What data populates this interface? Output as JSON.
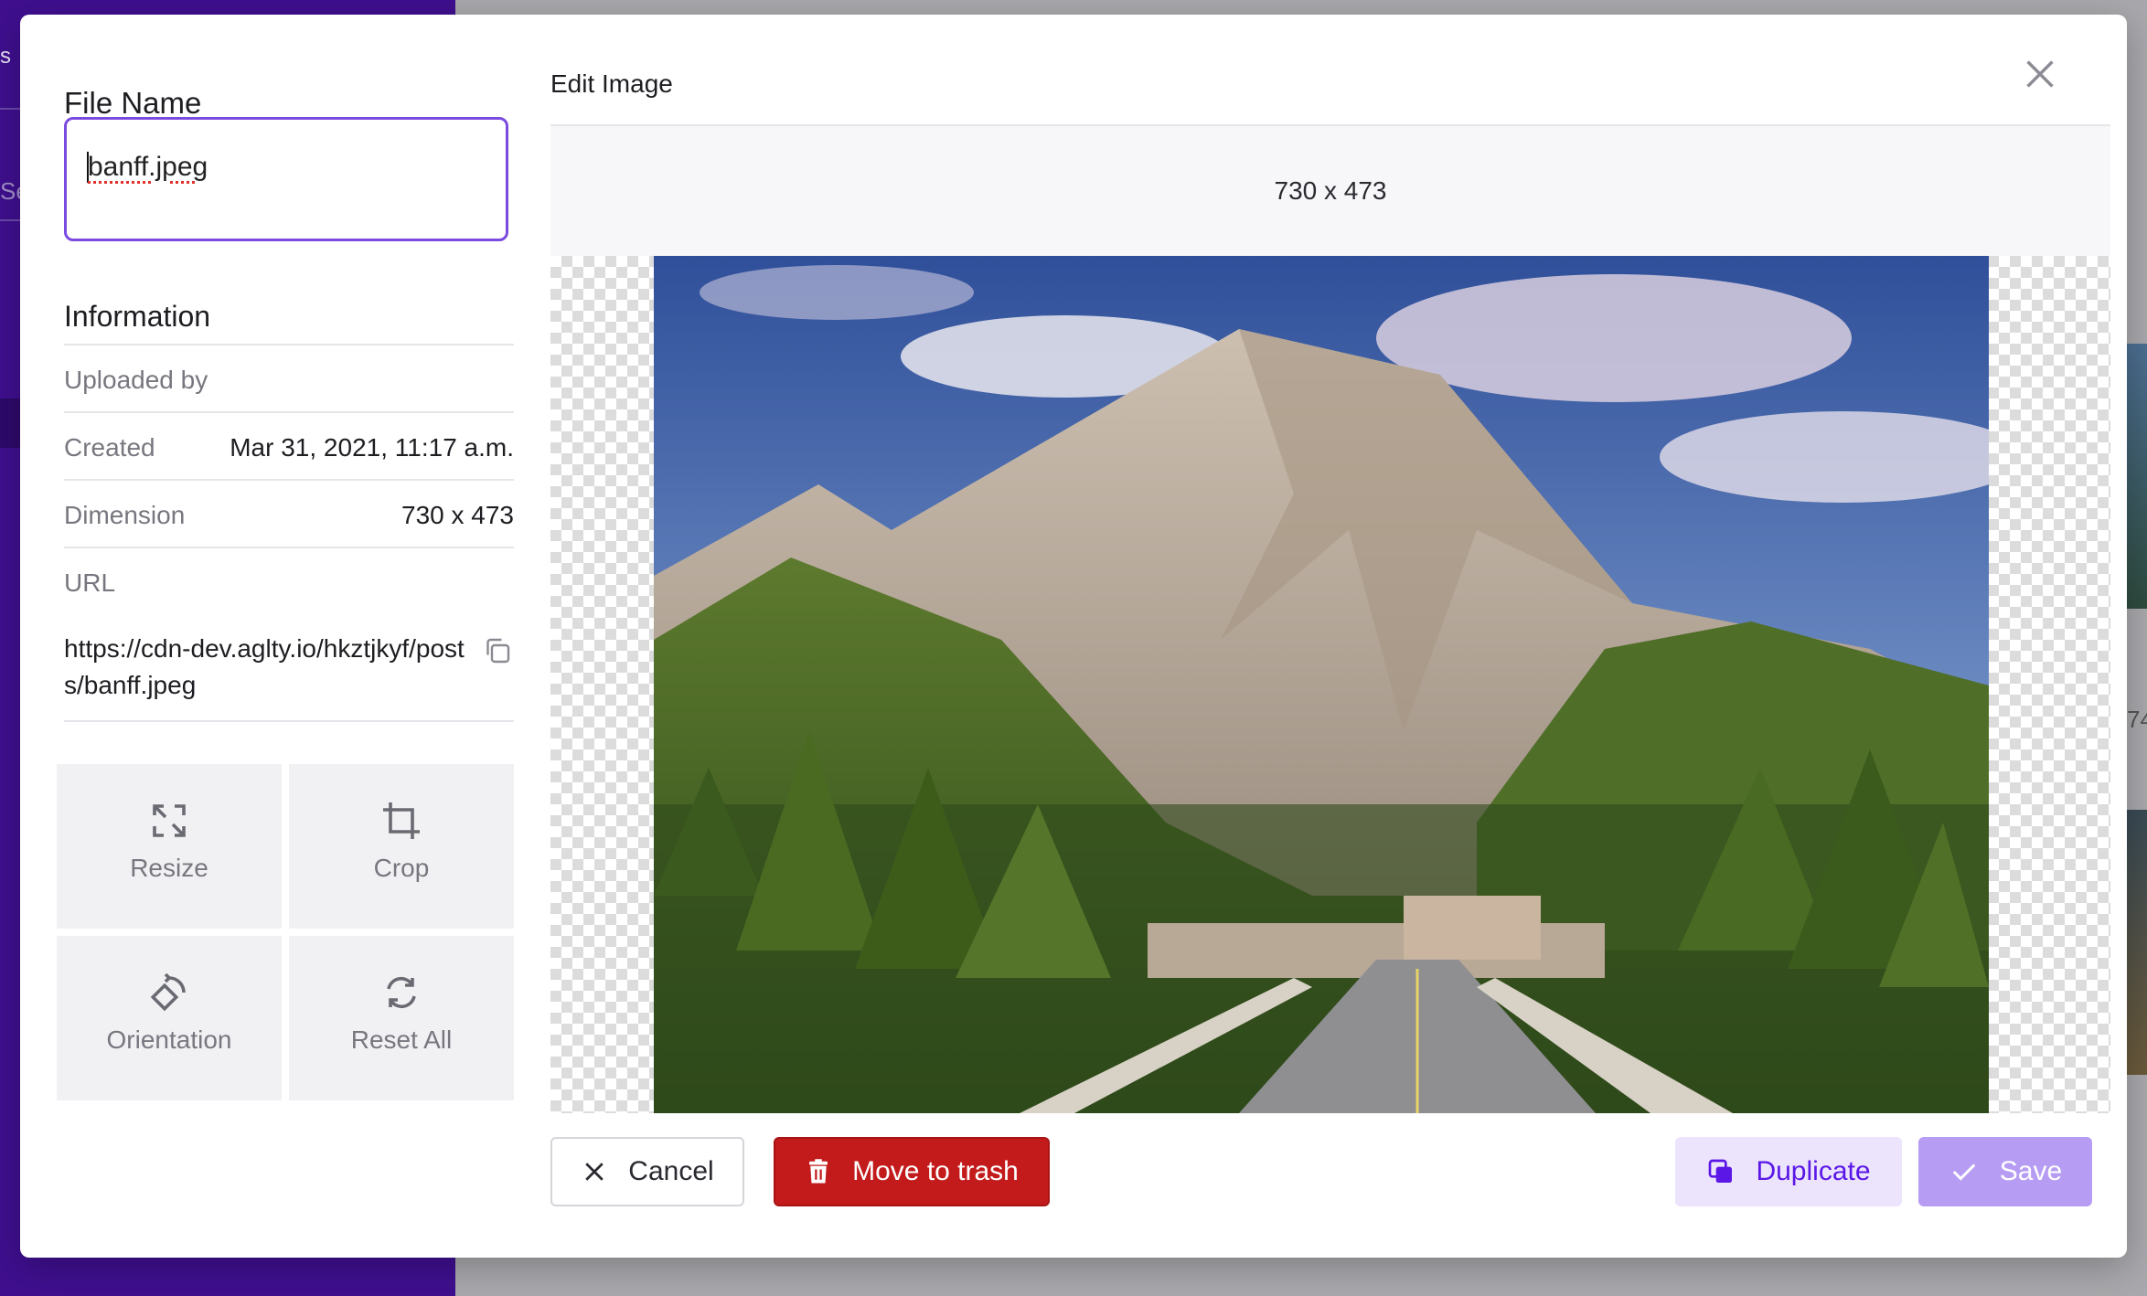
{
  "background": {
    "sidebar_fragment_text": "s",
    "search_fragment_text": "Se",
    "side_number_fragment": "74"
  },
  "file_name": {
    "label": "File Name",
    "value": "banff.jpeg"
  },
  "information": {
    "title": "Information",
    "uploaded_by_label": "Uploaded by",
    "uploaded_by_value": "",
    "created_label": "Created",
    "created_value": "Mar 31, 2021, 11:17 a.m.",
    "dimension_label": "Dimension",
    "dimension_value": "730 x 473",
    "url_label": "URL",
    "url_value": "https://cdn-dev.aglty.io/hkztjkyf/posts/banff.jpeg"
  },
  "tools": [
    {
      "label": "Resize",
      "icon": "resize-icon"
    },
    {
      "label": "Crop",
      "icon": "crop-icon"
    },
    {
      "label": "Orientation",
      "icon": "orientation-icon"
    },
    {
      "label": "Reset All",
      "icon": "reset-icon"
    }
  ],
  "editor": {
    "title": "Edit Image",
    "dimension_display": "730 x 473",
    "close_icon": "close-icon"
  },
  "actions": {
    "cancel_label": "Cancel",
    "trash_label": "Move to trash",
    "duplicate_label": "Duplicate",
    "save_label": "Save"
  },
  "colors": {
    "accent": "#7b4be0",
    "danger": "#c31b1b",
    "duplicate_bg": "#ece3fd",
    "duplicate_text": "#5a17e6",
    "save_bg": "#b79cf3",
    "sidebar": "#3f0f8f"
  }
}
